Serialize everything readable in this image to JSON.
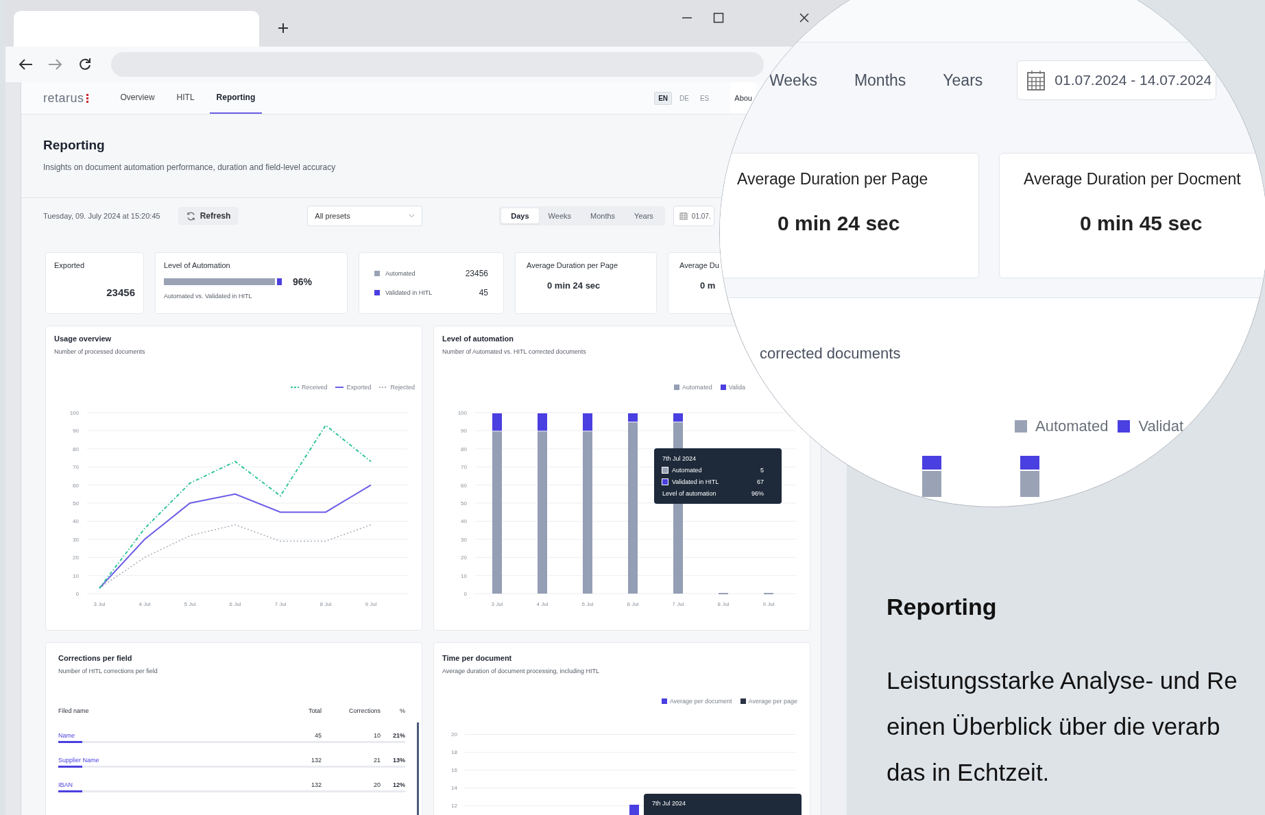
{
  "app": {
    "logo": "retarus",
    "nav": [
      {
        "label": "Overview",
        "selected": false
      },
      {
        "label": "HITL",
        "selected": false
      },
      {
        "label": "Reporting",
        "selected": true
      }
    ],
    "languages": [
      {
        "label": "EN",
        "selected": true
      },
      {
        "label": "DE",
        "selected": false
      },
      {
        "label": "ES",
        "selected": false
      }
    ],
    "about": "Abou",
    "page_title": "Reporting",
    "page_subtitle": "Insights on document automation performance, duration and field-level accuracy",
    "toolbar": {
      "timestamp": "Tuesday, 09. July 2024 at 15:20:45",
      "refresh": "Refresh",
      "preset": "All presets",
      "periods": [
        {
          "label": "Days",
          "selected": true
        },
        {
          "label": "Weeks",
          "selected": false
        },
        {
          "label": "Months",
          "selected": false
        },
        {
          "label": "Years",
          "selected": false
        }
      ],
      "date_range": "01.07."
    },
    "kpis": [
      {
        "kind": "value",
        "title": "Exported",
        "value": "23456"
      },
      {
        "kind": "bar",
        "title": "Level of Automation",
        "level": 0.96,
        "reading": "96%",
        "caption": "Automated vs. Validated in HITL"
      },
      {
        "kind": "legend",
        "items": [
          {
            "label": "Automated",
            "value": "23456",
            "color": "#9aa3b5"
          },
          {
            "label": "Validated in HITL",
            "value": "45",
            "color": "#4a3fe0"
          }
        ]
      },
      {
        "kind": "duration",
        "title": "Average Duration per Page",
        "value": "0 min 24 sec"
      },
      {
        "kind": "duration",
        "title": "Average Du",
        "value": "0 m"
      }
    ],
    "usage_chart": {
      "title": "Usage overview",
      "subtitle": "Number of processed documents",
      "chart_data": {
        "type": "line",
        "categories": [
          "3 Jul",
          "4 Jul",
          "5 Jul",
          "6 Jul",
          "7 Jul",
          "8 Jul",
          "9 Jul"
        ],
        "series": [
          {
            "name": "Received",
            "color": "#2fc39a",
            "line_style": "dashdot",
            "values": [
              3,
              36,
              61,
              73,
              54,
              93,
              73
            ]
          },
          {
            "name": "Exported",
            "color": "#6b5ce7",
            "line_style": "solid",
            "values": [
              3,
              30,
              50,
              55,
              45,
              45,
              60
            ]
          },
          {
            "name": "Rejected",
            "color": "#a9adb5",
            "line_style": "dotted",
            "values": [
              3,
              20,
              32,
              38,
              29,
              29,
              38
            ]
          }
        ],
        "ylim": [
          0,
          100
        ],
        "yticks": [
          0,
          10,
          20,
          30,
          40,
          50,
          60,
          70,
          80,
          90,
          100
        ],
        "grid": true
      }
    },
    "automation_chart": {
      "title": "Level of automation",
      "subtitle": "Number of Automated vs. HITL corrected documents",
      "chart_data": {
        "type": "bar",
        "stacked": true,
        "categories": [
          "3 Jul",
          "4 Jul",
          "5 Jul",
          "6 Jul",
          "7 Jul",
          "8 Jul",
          "9 Jul"
        ],
        "series": [
          {
            "name": "Automated",
            "color": "#949eb4",
            "values": [
              90,
              90,
              90,
              95,
              95,
              0,
              0
            ]
          },
          {
            "name": "Valida",
            "color": "#4a3fe0",
            "values": [
              10,
              10,
              10,
              5,
              5,
              0,
              0
            ]
          }
        ],
        "ylim": [
          0,
          100
        ],
        "yticks": [
          0,
          10,
          20,
          30,
          40,
          50,
          60,
          70,
          80,
          90,
          100
        ],
        "grid": true
      },
      "tooltip": {
        "title": "7th Jul 2024",
        "rows": [
          {
            "label": "Automated",
            "value": "5",
            "color": "#9aa3b5"
          },
          {
            "label": "Validated in HITL",
            "value": "67",
            "color": "#4a3fe0"
          },
          {
            "label": "Level of automation",
            "value": "96%"
          }
        ]
      }
    },
    "corrections": {
      "title": "Corrections per field",
      "subtitle": "Number of HITL corrections per field",
      "columns": [
        "Filed name",
        "Total",
        "Corrections",
        "%"
      ],
      "rows": [
        {
          "name": "Name",
          "total": "45",
          "corrections": "10",
          "percent": "21%",
          "level": 0.07
        },
        {
          "name": "Supplier Name",
          "total": "132",
          "corrections": "21",
          "percent": "13%",
          "level": 0.07
        },
        {
          "name": "IBAN",
          "total": "132",
          "corrections": "20",
          "percent": "12%",
          "level": 0.07
        }
      ]
    },
    "time_chart": {
      "title": "Time per document",
      "subtitle": "Average duration of document processing, including HITL",
      "legend": [
        {
          "label": "Average per document",
          "color": "#4a3fe0"
        },
        {
          "label": "Average per page",
          "color": "#2b3345"
        }
      ],
      "y_labels": [
        "20",
        "18",
        "16",
        "14",
        "12"
      ],
      "tooltip_title": "7th Jul 2024"
    }
  },
  "magnifier": {
    "periods": [
      "Weeks",
      "Months",
      "Years"
    ],
    "date_range": "01.07.2024 - 14.07.2024",
    "cards": [
      {
        "title": "Average Duration per Page",
        "value": "0 min 24 sec"
      },
      {
        "title": "Average Duration per Docment",
        "value": "0 min 45 sec"
      }
    ],
    "caption": "corrected documents",
    "legend": [
      {
        "label": "Automated",
        "color": "#9aa3b5"
      },
      {
        "label": "Validat",
        "color": "#4a3fe0"
      }
    ]
  },
  "feature": {
    "title": "Reporting",
    "text": "Leistungsstarke Analyse- und Re\neinen Überblick über die verarb\ndas in Echtzeit."
  }
}
